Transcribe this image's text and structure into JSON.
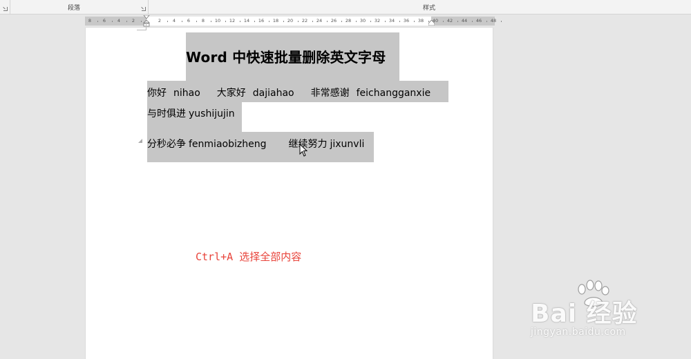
{
  "ribbon": {
    "groups": [
      {
        "label": "段落"
      },
      {
        "label": "样式"
      }
    ]
  },
  "ruler": {
    "numbers": [
      "8",
      "6",
      "4",
      "2",
      "2",
      "4",
      "6",
      "8",
      "10",
      "12",
      "14",
      "16",
      "18",
      "20",
      "22",
      "24",
      "26",
      "28",
      "30",
      "32",
      "34",
      "36",
      "38",
      "40",
      "42",
      "44",
      "46",
      "48"
    ]
  },
  "document": {
    "title": "Word 中快速批量删除英文字母",
    "lines": [
      {
        "parts": [
          "你好",
          "nihao",
          "大家好",
          "dajiahao",
          "非常感谢",
          "feichangganxie"
        ]
      },
      {
        "parts": [
          "与时俱进",
          "yushijujin"
        ]
      },
      {
        "parts": [
          "分秒必争",
          "fenmiaobizheng",
          "继续努力",
          "jixunvli"
        ]
      }
    ],
    "selection_color": "#c6c6c6"
  },
  "annotation": {
    "text": "Ctrl+A 选择全部内容",
    "color": "#e8433a"
  },
  "watermark": {
    "brand": "Bai 经验",
    "sub": "jingyan.baidu.com"
  },
  "icons": {
    "paragraph_launcher": "dialog-launcher-icon",
    "styles_launcher": "dialog-launcher-icon",
    "cursor": "mouse-pointer-icon",
    "paw": "baidu-paw-icon"
  }
}
